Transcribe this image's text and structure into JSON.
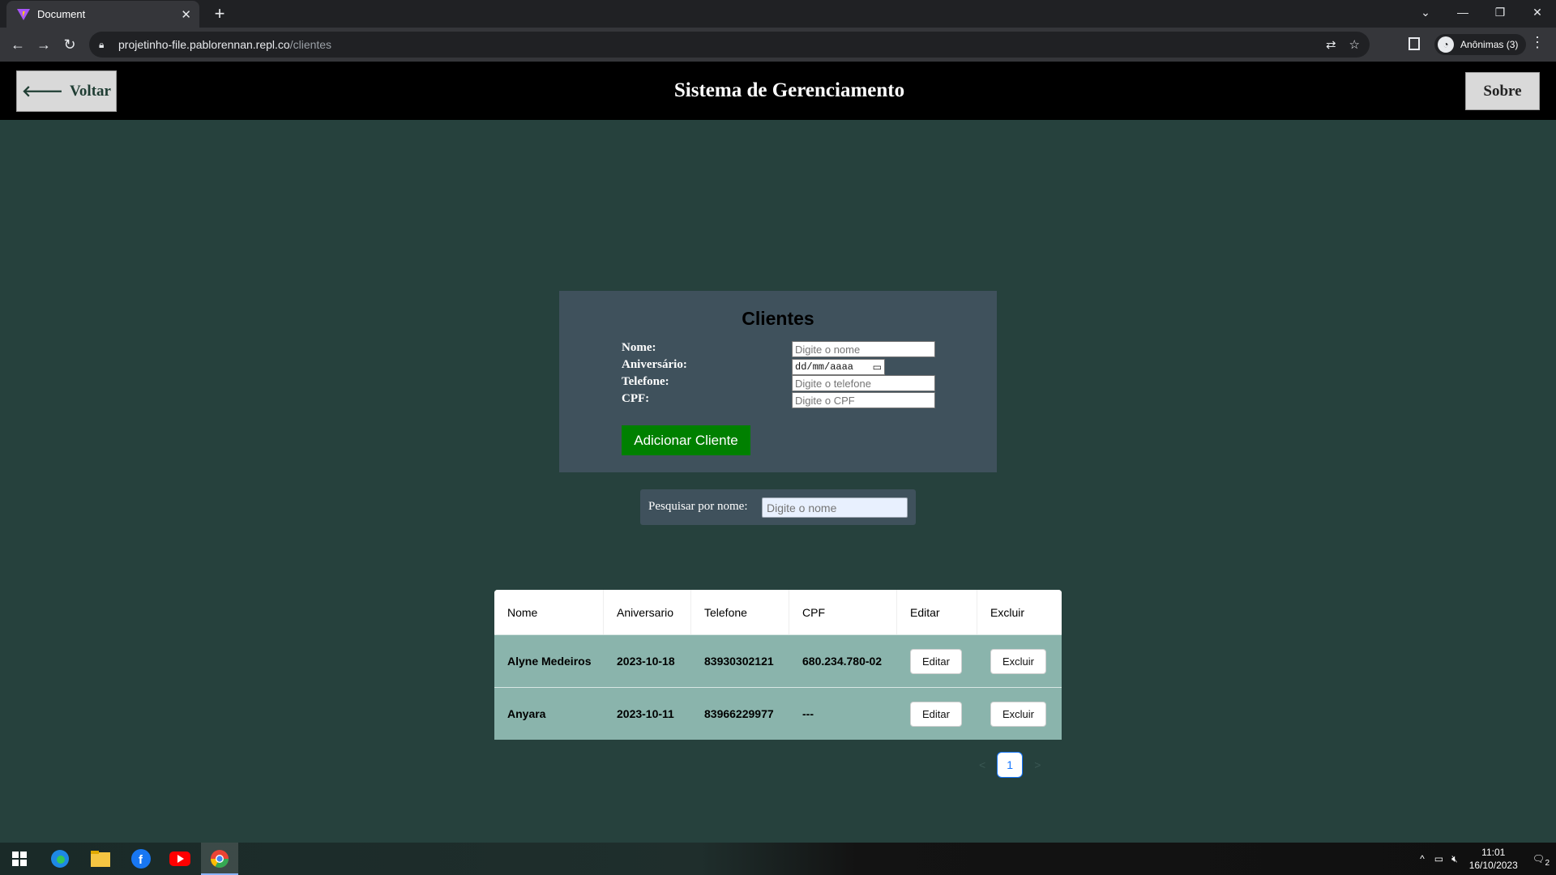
{
  "browser": {
    "tab_title": "Document",
    "url_host": "projetinho-file.pablorennan.repl.co",
    "url_path": "/clientes",
    "profile_label": "Anônimas (3)"
  },
  "header": {
    "back_label": "Voltar",
    "title": "Sistema de Gerenciamento",
    "about_label": "Sobre"
  },
  "form": {
    "title": "Clientes",
    "nome_label": "Nome:",
    "nome_placeholder": "Digite o nome",
    "aniversario_label": "Aniversário:",
    "aniversario_value": "dd/mm/aaaa",
    "telefone_label": "Telefone:",
    "telefone_placeholder": "Digite o telefone",
    "cpf_label": "CPF:",
    "cpf_placeholder": "Digite o CPF",
    "add_label": "Adicionar Cliente"
  },
  "search": {
    "label": "Pesquisar por nome:",
    "placeholder": "Digite o nome"
  },
  "table": {
    "headers": [
      "Nome",
      "Aniversario",
      "Telefone",
      "CPF",
      "Editar",
      "Excluir"
    ],
    "rows": [
      {
        "nome": "Alyne Medeiros",
        "aniversario": "2023-10-18",
        "telefone": "83930302121",
        "cpf": "680.234.780-02",
        "editar": "Editar",
        "excluir": "Excluir"
      },
      {
        "nome": "Anyara",
        "aniversario": "2023-10-11",
        "telefone": "83966229977",
        "cpf": "---",
        "editar": "Editar",
        "excluir": "Excluir"
      }
    ]
  },
  "pagination": {
    "prev": "<",
    "current": "1",
    "next": ">"
  },
  "taskbar": {
    "time": "11:01",
    "date": "16/10/2023",
    "notifications": "2"
  },
  "colors": {
    "page_bg": "#26413d",
    "panel_bg": "#3f515c",
    "add_button": "#008000",
    "row_bg": "#8ab4ac"
  }
}
